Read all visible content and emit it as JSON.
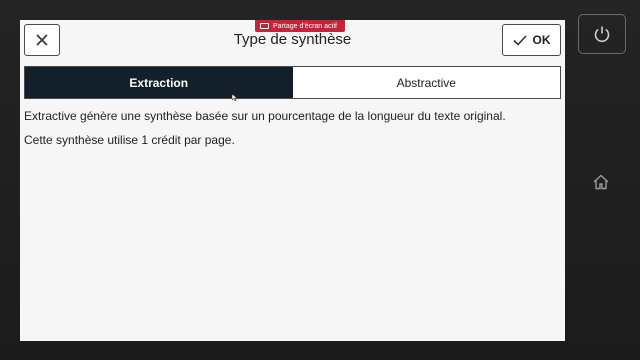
{
  "banner": {
    "text": "Partage d'écran actif",
    "icon": "cast-icon"
  },
  "header": {
    "title": "Type de synthèse",
    "close_icon": "close-icon",
    "ok_label": "OK",
    "ok_icon": "check-icon"
  },
  "tabs": [
    {
      "label": "Extraction",
      "active": true
    },
    {
      "label": "Abstractive",
      "active": false
    }
  ],
  "content": {
    "description": "Extractive génère une synthèse basée sur un pourcentage de la longueur du texte original.",
    "credit_note": "Cette synthèse utilise 1 crédit par page."
  },
  "device": {
    "power_icon": "power-icon",
    "home_icon": "home-icon"
  },
  "colors": {
    "active_tab": "#13202b",
    "banner": "#c4233a",
    "screen": "#f6f6f7"
  }
}
